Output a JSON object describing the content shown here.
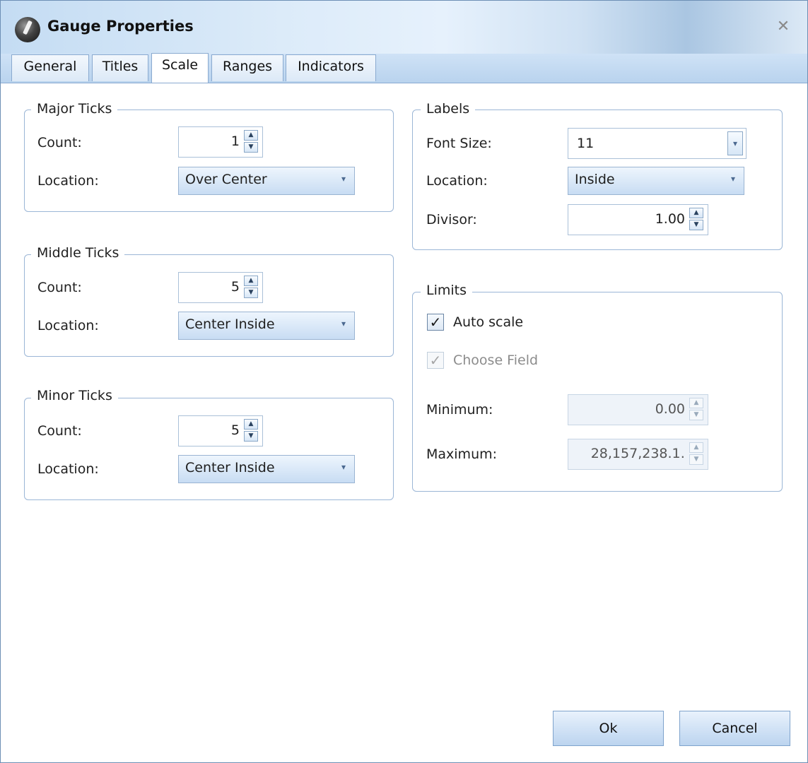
{
  "window": {
    "title": "Gauge Properties"
  },
  "tabs": [
    {
      "label": "General"
    },
    {
      "label": "Titles"
    },
    {
      "label": "Scale"
    },
    {
      "label": "Ranges"
    },
    {
      "label": "Indicators"
    }
  ],
  "active_tab": "Scale",
  "major_ticks": {
    "legend": "Major Ticks",
    "count_label": "Count:",
    "count": "1",
    "location_label": "Location:",
    "location": "Over Center"
  },
  "middle_ticks": {
    "legend": "Middle Ticks",
    "count_label": "Count:",
    "count": "5",
    "location_label": "Location:",
    "location": "Center Inside"
  },
  "minor_ticks": {
    "legend": "Minor Ticks",
    "count_label": "Count:",
    "count": "5",
    "location_label": "Location:",
    "location": "Center Inside"
  },
  "labels": {
    "legend": "Labels",
    "font_size_label": "Font Size:",
    "font_size": "11",
    "location_label": "Location:",
    "location": "Inside",
    "divisor_label": "Divisor:",
    "divisor": "1.00"
  },
  "limits": {
    "legend": "Limits",
    "auto_scale_label": "Auto scale",
    "auto_scale_checked": true,
    "choose_field_label": "Choose Field",
    "choose_field_checked": true,
    "choose_field_enabled": false,
    "minimum_label": "Minimum:",
    "minimum": "0.00",
    "maximum_label": "Maximum:",
    "maximum": "28,157,238.1․"
  },
  "buttons": {
    "ok": "Ok",
    "cancel": "Cancel"
  },
  "icons": {
    "app": "gauge-icon",
    "close": "close-icon",
    "spin_up": "spin-up-icon",
    "spin_down": "spin-down-icon",
    "dropdown": "chevron-down-icon",
    "check": "checkmark-icon"
  }
}
